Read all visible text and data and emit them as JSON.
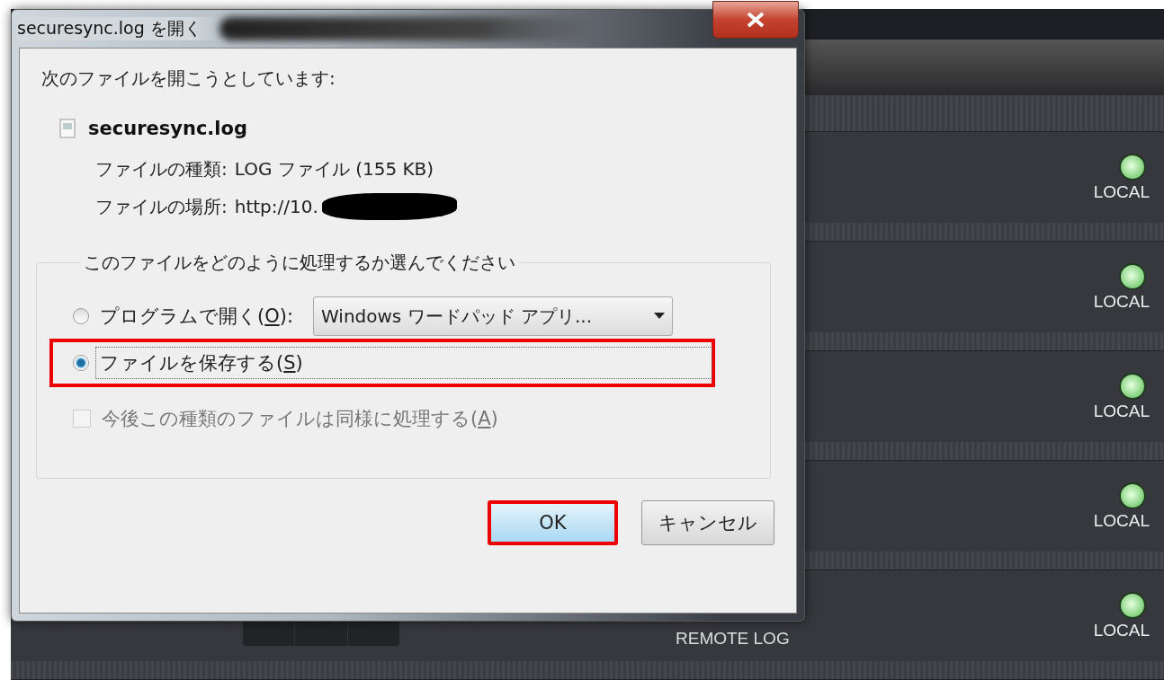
{
  "app": {
    "rows": [
      {
        "status": "LOCAL",
        "on": true
      },
      {
        "status": "LOCAL",
        "on": true
      },
      {
        "status": "LOCAL",
        "on": true
      },
      {
        "status": "LOCAL",
        "on": true
      },
      {
        "status": "LOCAL",
        "on": true,
        "extra_label": "REMOTE LOG"
      }
    ]
  },
  "dialog": {
    "title": "securesync.log を開く",
    "intro": "次のファイルを開こうとしています:",
    "file_name": "securesync.log",
    "details": [
      {
        "label": "ファイルの種類:",
        "value": "LOG ファイル (155 KB)",
        "redacted": false
      },
      {
        "label": "ファイルの場所:",
        "value": "http://10.",
        "redacted": true
      }
    ],
    "group_label": "このファイルをどのように処理するか選んでください",
    "options": [
      {
        "kind": "program",
        "prefix": "プログラムで開く(",
        "mnemonic": "O",
        "suffix": "):",
        "selected": false,
        "highlighted": false,
        "program": "Windows ワードパッド アプリ..."
      },
      {
        "kind": "save",
        "prefix": "ファイルを保存する(",
        "mnemonic": "S",
        "suffix": ")",
        "selected": true,
        "highlighted": true
      }
    ],
    "remember": {
      "prefix": "今後この種類のファイルは同様に処理する(",
      "mnemonic": "A",
      "suffix": ")",
      "checked": false,
      "disabled": true
    },
    "buttons": [
      {
        "label": "OK",
        "default": true,
        "highlighted": true
      },
      {
        "label": "キャンセル",
        "default": false,
        "highlighted": false
      }
    ]
  }
}
